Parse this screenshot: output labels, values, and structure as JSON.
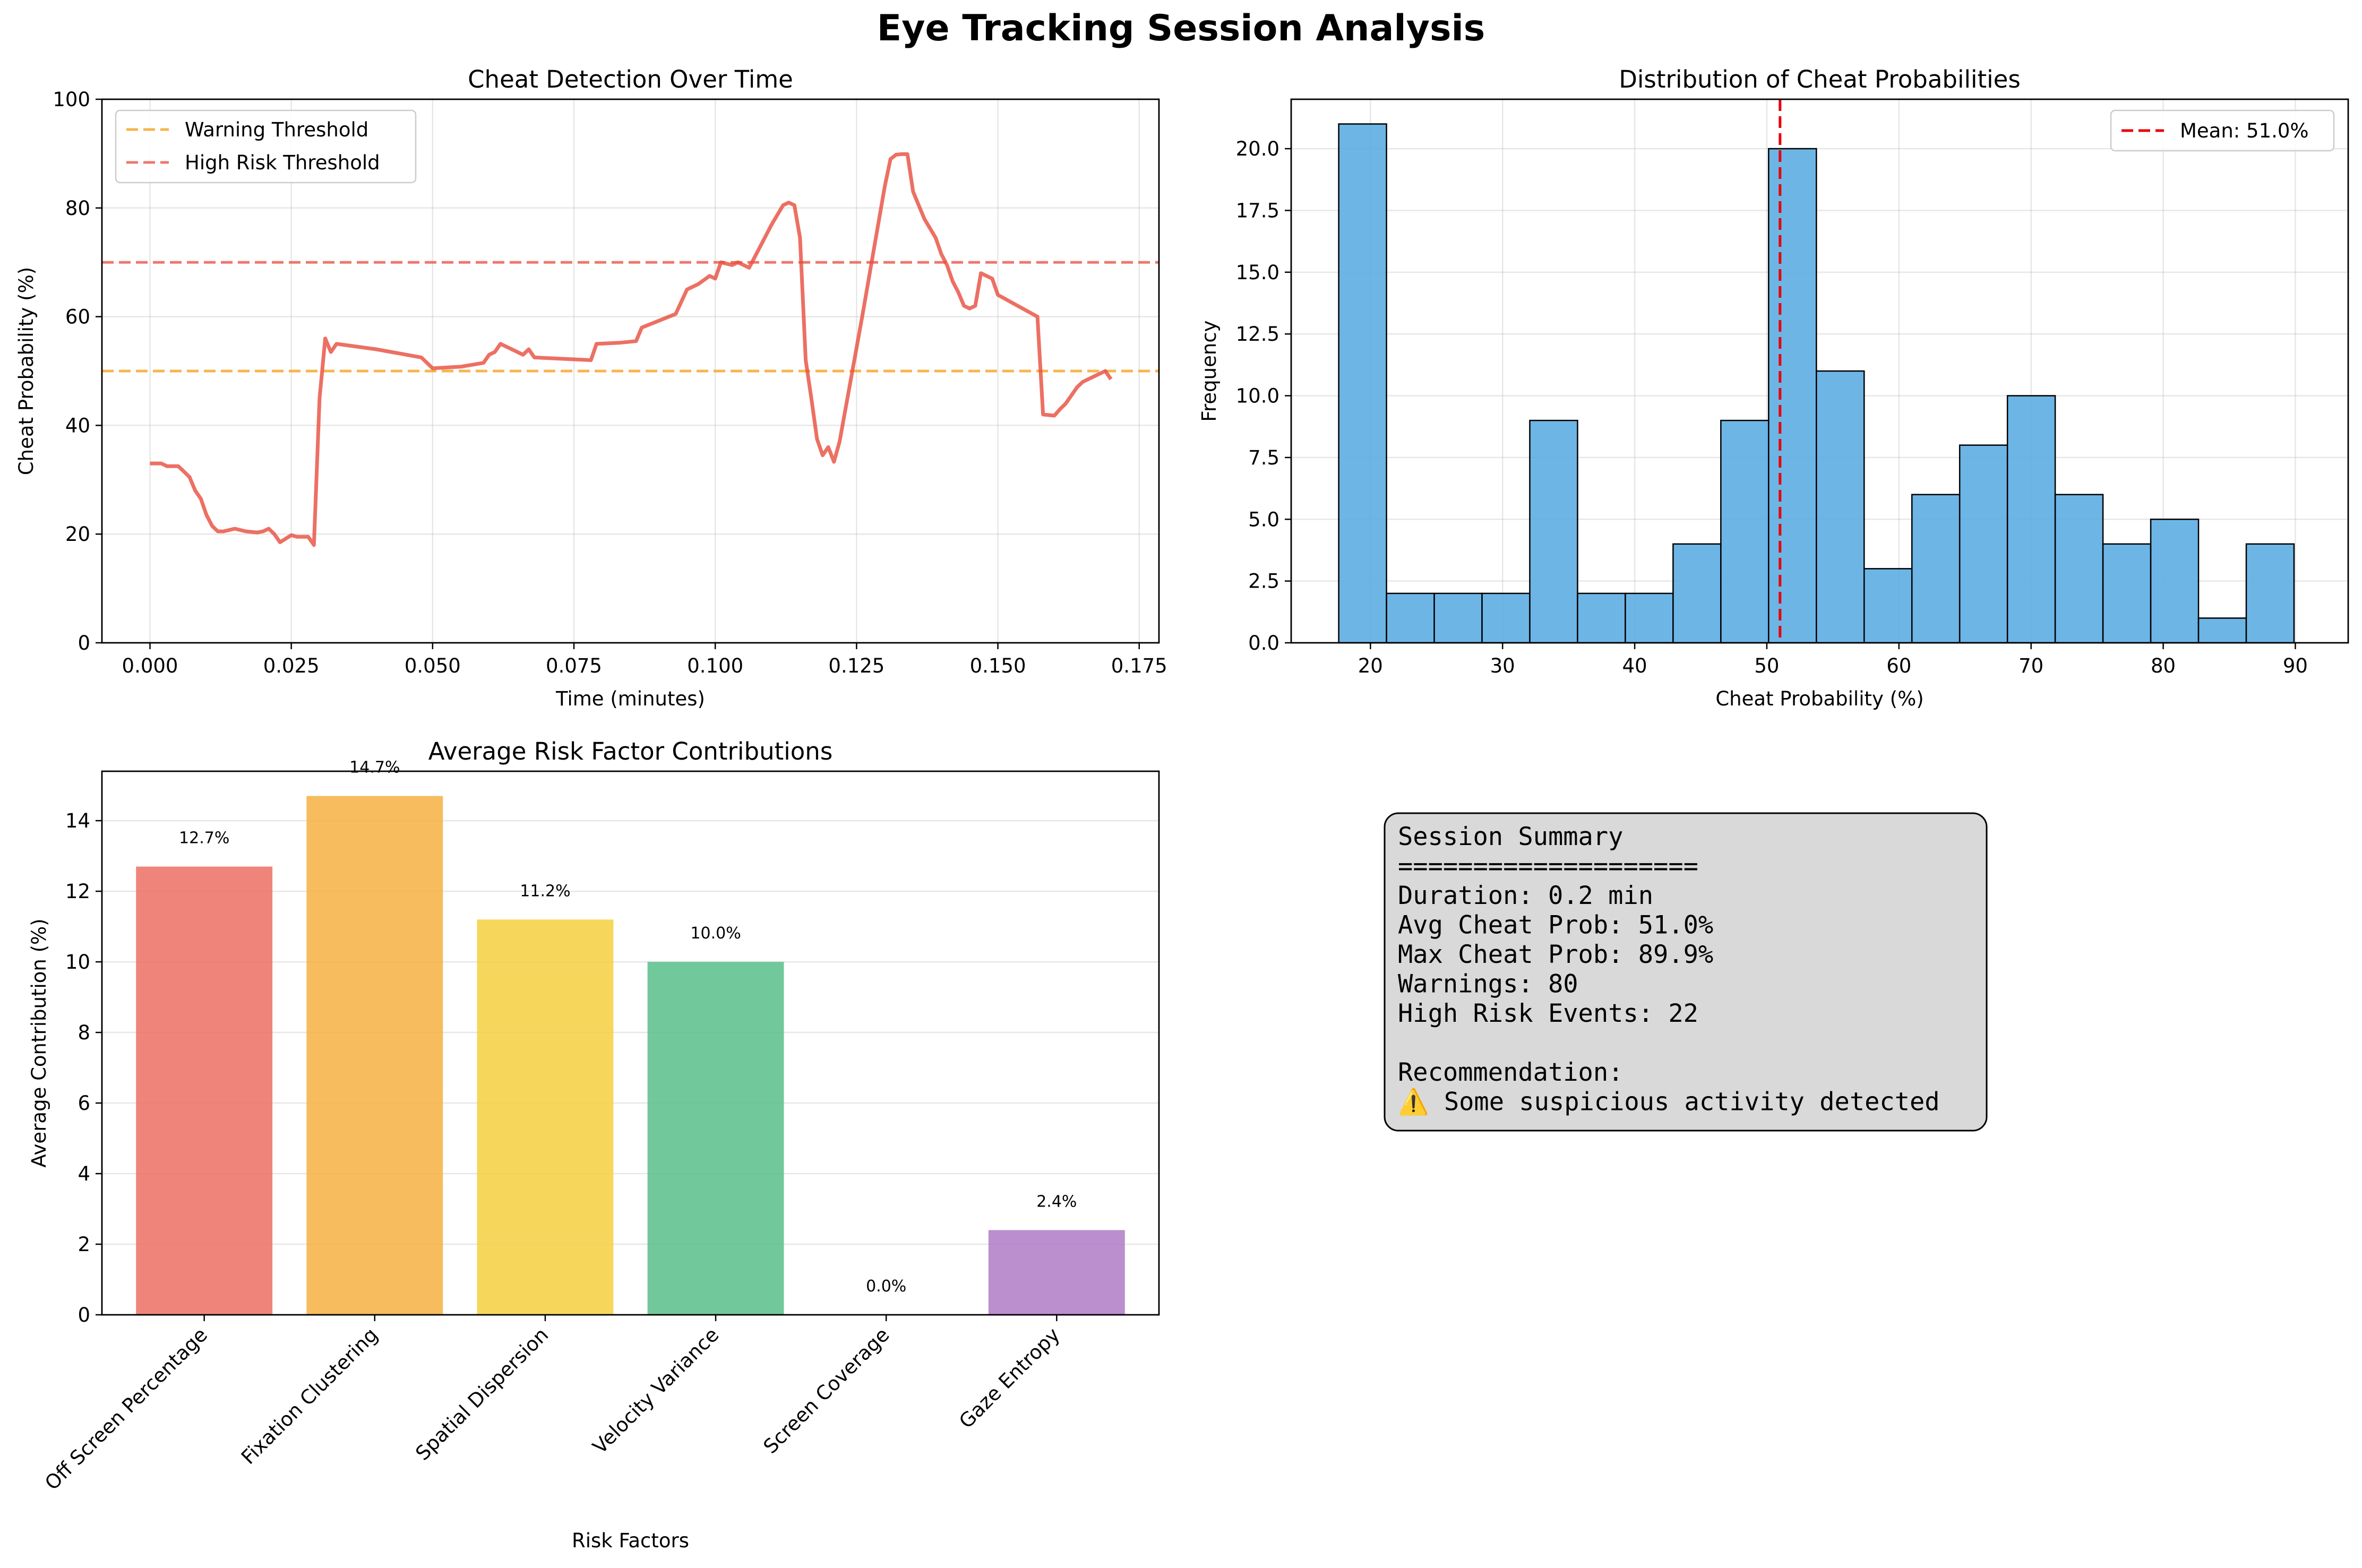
{
  "page": {
    "title": "Eye Tracking Session Analysis"
  },
  "chart_data": [
    {
      "type": "line",
      "title": "Cheat Detection Over Time",
      "xlabel": "Time (minutes)",
      "ylabel": "Cheat Probability (%)",
      "xlim": [
        -0.0085,
        0.1785
      ],
      "ylim": [
        0,
        100
      ],
      "xticks": [
        "0.000",
        "0.025",
        "0.050",
        "0.075",
        "0.100",
        "0.125",
        "0.150",
        "0.175"
      ],
      "yticks": [
        "0",
        "20",
        "40",
        "60",
        "80",
        "100"
      ],
      "grid": true,
      "legend": "top-left",
      "color": "#e74c3c",
      "series": [
        {
          "x": [
            0.0,
            0.002,
            0.003,
            0.005,
            0.006,
            0.007,
            0.008,
            0.009,
            0.01,
            0.011,
            0.012,
            0.013,
            0.015,
            0.017,
            0.019,
            0.02,
            0.021,
            0.022,
            0.023,
            0.025,
            0.026,
            0.028,
            0.029,
            0.03,
            0.031,
            0.032,
            0.033,
            0.04,
            0.048,
            0.05,
            0.055,
            0.059,
            0.06,
            0.061,
            0.062,
            0.064,
            0.066,
            0.067,
            0.068,
            0.078,
            0.079,
            0.083,
            0.086,
            0.087,
            0.093,
            0.095,
            0.097,
            0.099,
            0.1,
            0.101,
            0.103,
            0.104,
            0.106,
            0.108,
            0.11,
            0.112,
            0.113,
            0.114,
            0.115,
            0.116,
            0.117,
            0.118,
            0.119,
            0.12,
            0.121,
            0.122,
            0.126,
            0.128,
            0.13,
            0.131,
            0.132,
            0.133,
            0.134,
            0.135,
            0.137,
            0.139,
            0.14,
            0.141,
            0.142,
            0.143,
            0.144,
            0.145,
            0.146,
            0.147,
            0.149,
            0.15,
            0.157,
            0.158,
            0.16,
            0.161,
            0.162,
            0.164,
            0.165,
            0.166,
            0.167,
            0.168,
            0.169,
            0.17
          ],
          "y": [
            33.0,
            33.0,
            32.5,
            32.5,
            31.5,
            30.5,
            28.0,
            26.5,
            23.5,
            21.5,
            20.5,
            20.5,
            21.0,
            20.5,
            20.3,
            20.5,
            21.0,
            20.0,
            18.5,
            19.8,
            19.5,
            19.5,
            18.0,
            45.0,
            56.0,
            53.5,
            55.0,
            54.0,
            52.5,
            50.5,
            50.8,
            51.5,
            53.0,
            53.5,
            55.0,
            54.0,
            53.0,
            54.0,
            52.5,
            52.0,
            55.0,
            55.2,
            55.5,
            58.0,
            60.5,
            65.0,
            66.0,
            67.5,
            67.0,
            70.0,
            69.5,
            70.0,
            69.0,
            73.0,
            77.0,
            80.5,
            81.0,
            80.5,
            74.5,
            52.0,
            45.0,
            37.5,
            34.5,
            36.0,
            33.3,
            37.0,
            60.0,
            72.0,
            84.0,
            89.0,
            89.8,
            89.9,
            89.9,
            83.0,
            78.0,
            74.5,
            71.5,
            69.5,
            66.5,
            64.5,
            62.0,
            61.5,
            62.0,
            68.0,
            67.0,
            64.0,
            60.0,
            42.0,
            41.8,
            43.0,
            44.0,
            47.0,
            48.0,
            48.5,
            49.0,
            49.5,
            50.0,
            48.5
          ]
        }
      ],
      "reference_lines": [
        {
          "name": "Warning Threshold",
          "y": 50,
          "color": "#f39c12",
          "style": "dashed"
        },
        {
          "name": "High Risk Threshold",
          "y": 70,
          "color": "#e74c3c",
          "style": "dashed"
        }
      ]
    },
    {
      "type": "bar",
      "subtype": "histogram",
      "title": "Distribution of Cheat Probabilities",
      "xlabel": "Cheat Probability (%)",
      "ylabel": "Frequency",
      "xlim": [
        14.0,
        94.0
      ],
      "ylim": [
        0,
        22.0
      ],
      "xticks": [
        "20",
        "30",
        "40",
        "50",
        "60",
        "70",
        "80",
        "90"
      ],
      "yticks": [
        "0.0",
        "2.5",
        "5.0",
        "7.5",
        "10.0",
        "12.5",
        "15.0",
        "17.5",
        "20.0"
      ],
      "grid": true,
      "legend": "top-right",
      "color": "#5dade2",
      "bin_start": 17.6,
      "bin_width": 3.615,
      "values": [
        21,
        2,
        2,
        2,
        9,
        2,
        2,
        4,
        9,
        20,
        11,
        3,
        6,
        8,
        10,
        6,
        4,
        5,
        1,
        4
      ],
      "reference_lines": [
        {
          "name": "Mean: 51.0%",
          "x": 51.0,
          "color": "#e8000b",
          "style": "dashed"
        }
      ]
    },
    {
      "type": "bar",
      "title": "Average Risk Factor Contributions",
      "xlabel": "Risk Factors",
      "ylabel": "Average Contribution (%)",
      "ylim": [
        0,
        15.4
      ],
      "yticks": [
        "0",
        "2",
        "4",
        "6",
        "8",
        "10",
        "12",
        "14"
      ],
      "grid": true,
      "categories": [
        "Off Screen Percentage",
        "Fixation Clustering",
        "Spatial Dispersion",
        "Velocity Variance",
        "Screen Coverage",
        "Gaze Entropy"
      ],
      "values": [
        12.7,
        14.7,
        11.2,
        10.0,
        0.0,
        2.4
      ],
      "value_labels": [
        "12.7%",
        "14.7%",
        "11.2%",
        "10.0%",
        "0.0%",
        "2.4%"
      ],
      "colors": [
        "#ec7063",
        "#f5b041",
        "#f4d03f",
        "#58c08a",
        "#e5e5e5",
        "#af7ac5"
      ]
    }
  ],
  "summary": {
    "lines": [
      "Session Summary",
      "====================",
      "Duration: 0.2 min",
      "Avg Cheat Prob: 51.0%",
      "Max Cheat Prob: 89.9%",
      "Warnings: 80",
      "High Risk Events: 22",
      "",
      "Recommendation:",
      "⚠️ Some suspicious activity detected"
    ]
  }
}
